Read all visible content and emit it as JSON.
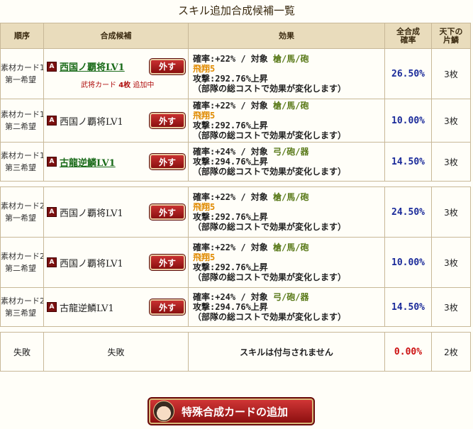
{
  "page_title": "スキル追加合成候補一覧",
  "headers": {
    "order": "順序",
    "candidate": "合成候補",
    "effect": "効果",
    "rate_l1": "全合成",
    "rate_l2": "確率",
    "count_l1": "天下の",
    "count_l2": "片鱗"
  },
  "rows": [
    {
      "order_l1": "素材カード1",
      "order_l2": "第一希望",
      "rarity": "A",
      "name": "西国ノ覇将LV1",
      "remove": "外す",
      "note_prefix": "武将カード",
      "note_count": "4枚",
      "note_suffix": "追加中",
      "eff1": "確率:+22% / 対象",
      "target": "槍/馬/砲",
      "skill": "飛翔5",
      "eff3": "攻撃:292.76%上昇",
      "eff4": "（部隊の総コストで効果が変化します）",
      "rate": "26.50%",
      "count": "3枚"
    },
    {
      "order_l1": "素材カード1",
      "order_l2": "第二希望",
      "rarity": "A",
      "name": "西国ノ覇将LV1",
      "remove": "外す",
      "eff1": "確率:+22% / 対象",
      "target": "槍/馬/砲",
      "skill": "飛翔5",
      "eff3": "攻撃:292.76%上昇",
      "eff4": "（部隊の総コストで効果が変化します）",
      "rate": "10.00%",
      "count": "3枚"
    },
    {
      "order_l1": "素材カード1",
      "order_l2": "第三希望",
      "rarity": "A",
      "name": "古龍逆鱗LV1",
      "remove": "外す",
      "eff1": "確率:+24% / 対象",
      "target": "弓/砲/器",
      "eff3": "攻撃:294.76%上昇",
      "eff4": "（部隊の総コストで効果が変化します）",
      "rate": "14.50%",
      "count": "3枚"
    },
    {
      "order_l1": "素材カード2",
      "order_l2": "第一希望",
      "rarity": "A",
      "name": "西国ノ覇将LV1",
      "remove": "外す",
      "eff1": "確率:+22% / 対象",
      "target": "槍/馬/砲",
      "skill": "飛翔5",
      "eff3": "攻撃:292.76%上昇",
      "eff4": "（部隊の総コストで効果が変化します）",
      "rate": "24.50%",
      "count": "3枚"
    },
    {
      "order_l1": "素材カード2",
      "order_l2": "第二希望",
      "rarity": "A",
      "name": "西国ノ覇将LV1",
      "remove": "外す",
      "eff1": "確率:+22% / 対象",
      "target": "槍/馬/砲",
      "skill": "飛翔5",
      "eff3": "攻撃:292.76%上昇",
      "eff4": "（部隊の総コストで効果が変化します）",
      "rate": "10.00%",
      "count": "3枚"
    },
    {
      "order_l1": "素材カード2",
      "order_l2": "第三希望",
      "rarity": "A",
      "name": "古龍逆鱗LV1",
      "remove": "外す",
      "eff1": "確率:+24% / 対象",
      "target": "弓/砲/器",
      "eff3": "攻撃:294.76%上昇",
      "eff4": "（部隊の総コストで効果が変化します）",
      "rate": "14.50%",
      "count": "3枚"
    }
  ],
  "failure": {
    "order": "失敗",
    "candidate": "失敗",
    "effect": "スキルは付与されません",
    "rate": "0.00%",
    "count": "2枚"
  },
  "special_button": "特殊合成カードの追加",
  "colors": {
    "header_bg": "#e9dcbc",
    "remove_button": "#a81818",
    "rate_text": "#1a2a9a",
    "fail_rate": "#cc1010",
    "target_text": "#5a7a1a",
    "skill_text": "#e08a00",
    "link_text": "#1a6b1a"
  }
}
